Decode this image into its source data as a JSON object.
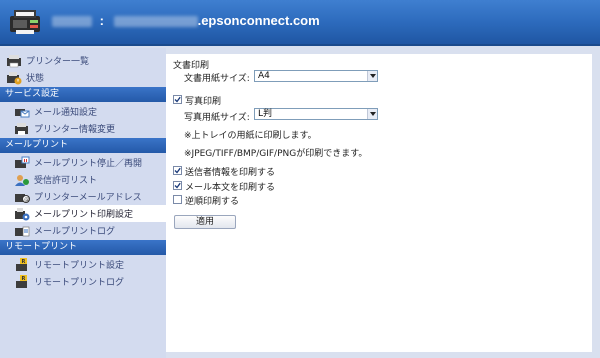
{
  "header": {
    "domain": ".epsonconnect.com",
    "separator": ":"
  },
  "sidebar": {
    "top_items": [
      {
        "label": "プリンター一覧",
        "icon": "printer-list-icon"
      },
      {
        "label": "状態",
        "icon": "printer-status-icon"
      }
    ],
    "sections": [
      {
        "title": "サービス設定",
        "items": [
          {
            "label": "メール通知設定",
            "icon": "mail-notify-icon"
          },
          {
            "label": "プリンター情報変更",
            "icon": "printer-info-icon"
          }
        ]
      },
      {
        "title": "メールプリント",
        "items": [
          {
            "label": "メールプリント停止／再開",
            "icon": "email-pause-icon"
          },
          {
            "label": "受信許可リスト",
            "icon": "allow-list-icon"
          },
          {
            "label": "プリンターメールアドレス",
            "icon": "printer-mail-address-icon"
          },
          {
            "label": "メールプリント印刷設定",
            "icon": "email-print-settings-icon",
            "active": true
          },
          {
            "label": "メールプリントログ",
            "icon": "email-print-log-icon"
          }
        ]
      },
      {
        "title": "リモートプリント",
        "items": [
          {
            "label": "リモートプリント設定",
            "icon": "remote-print-settings-icon"
          },
          {
            "label": "リモートプリントログ",
            "icon": "remote-print-log-icon"
          }
        ]
      }
    ]
  },
  "main": {
    "doc_print_heading": "文書印刷",
    "doc_paper_size_label": "文書用紙サイズ:",
    "doc_paper_size_value": "A4",
    "photo_print_label": "写真印刷",
    "photo_print_checked": true,
    "photo_paper_size_label": "写真用紙サイズ:",
    "photo_paper_size_value": "L判",
    "note_upper_tray": "※上トレイの用紙に印刷します。",
    "note_formats": "※JPEG/TIFF/BMP/GIF/PNGが印刷できます。",
    "options": [
      {
        "label": "送信者情報を印刷する",
        "checked": true
      },
      {
        "label": "メール本文を印刷する",
        "checked": true
      },
      {
        "label": "逆順印刷する",
        "checked": false
      }
    ],
    "apply_button": "適用"
  },
  "colors": {
    "header_blue": "#2d6bbd",
    "section_blue": "#2459a8",
    "sidebar_bg": "#d3dbef",
    "link_text": "#3a4a7a"
  }
}
